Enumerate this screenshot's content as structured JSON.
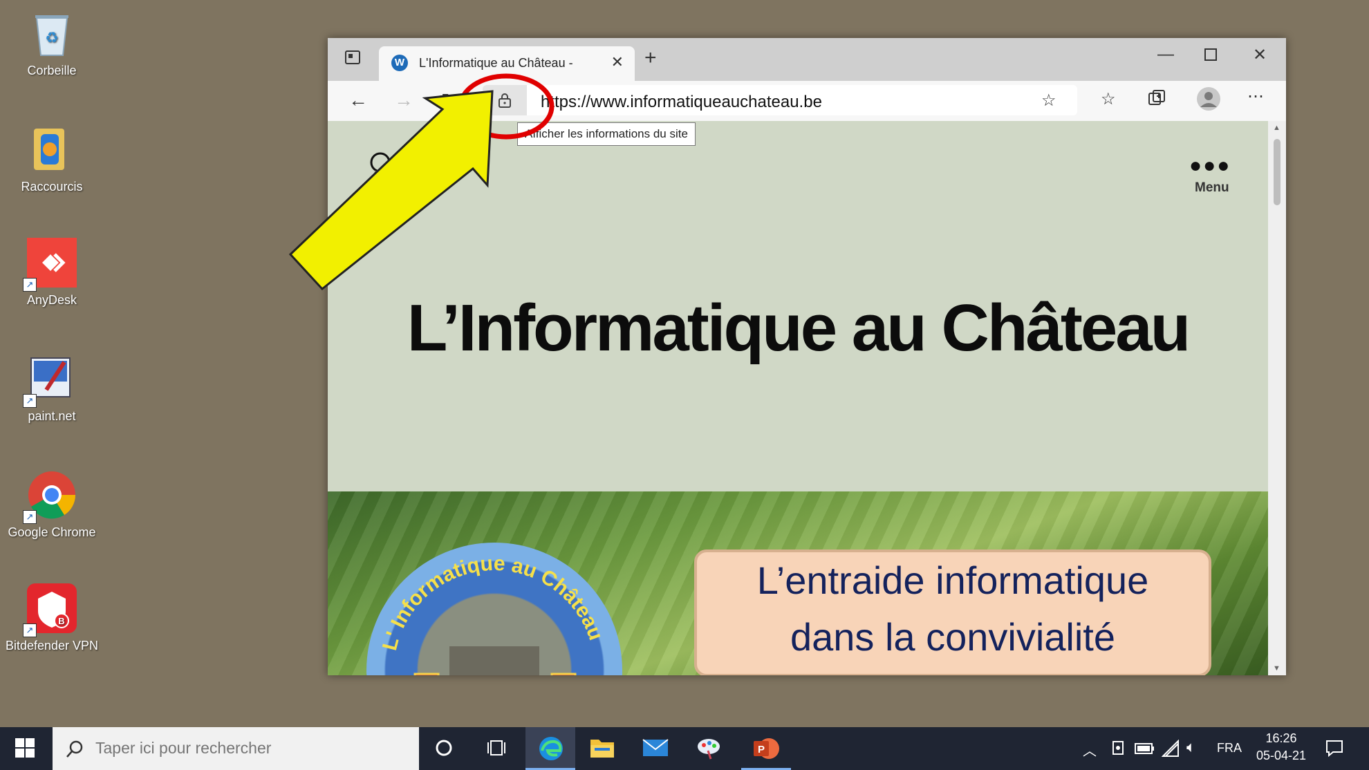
{
  "desktop": {
    "icons": [
      {
        "label": "Corbeille"
      },
      {
        "label": "Raccourcis"
      },
      {
        "label": "AnyDesk"
      },
      {
        "label": "paint.net"
      },
      {
        "label": "Google Chrome"
      },
      {
        "label": "Bitdefender VPN"
      }
    ]
  },
  "browser": {
    "tab_title": "L'Informatique au Château -",
    "url": "https://www.informatiqueauchateau.be",
    "tooltip": "Afficher les informations du site"
  },
  "page": {
    "title": "L’Informatique au Château",
    "menu_label": "Menu",
    "slogan_line1": "L’entraide informatique",
    "slogan_line2": "dans la convivialité",
    "seal_text": "L' Informatique au Château"
  },
  "taskbar": {
    "search_placeholder": "Taper ici pour rechercher",
    "language": "FRA",
    "time": "16:26",
    "date": "05-04-21"
  },
  "colors": {
    "desktop_bg": "#7f7460",
    "page_bg": "#d0d8c6",
    "taskbar_bg": "#1f2533",
    "annotation_circle": "#e00000",
    "annotation_arrow": "#f2f000"
  }
}
